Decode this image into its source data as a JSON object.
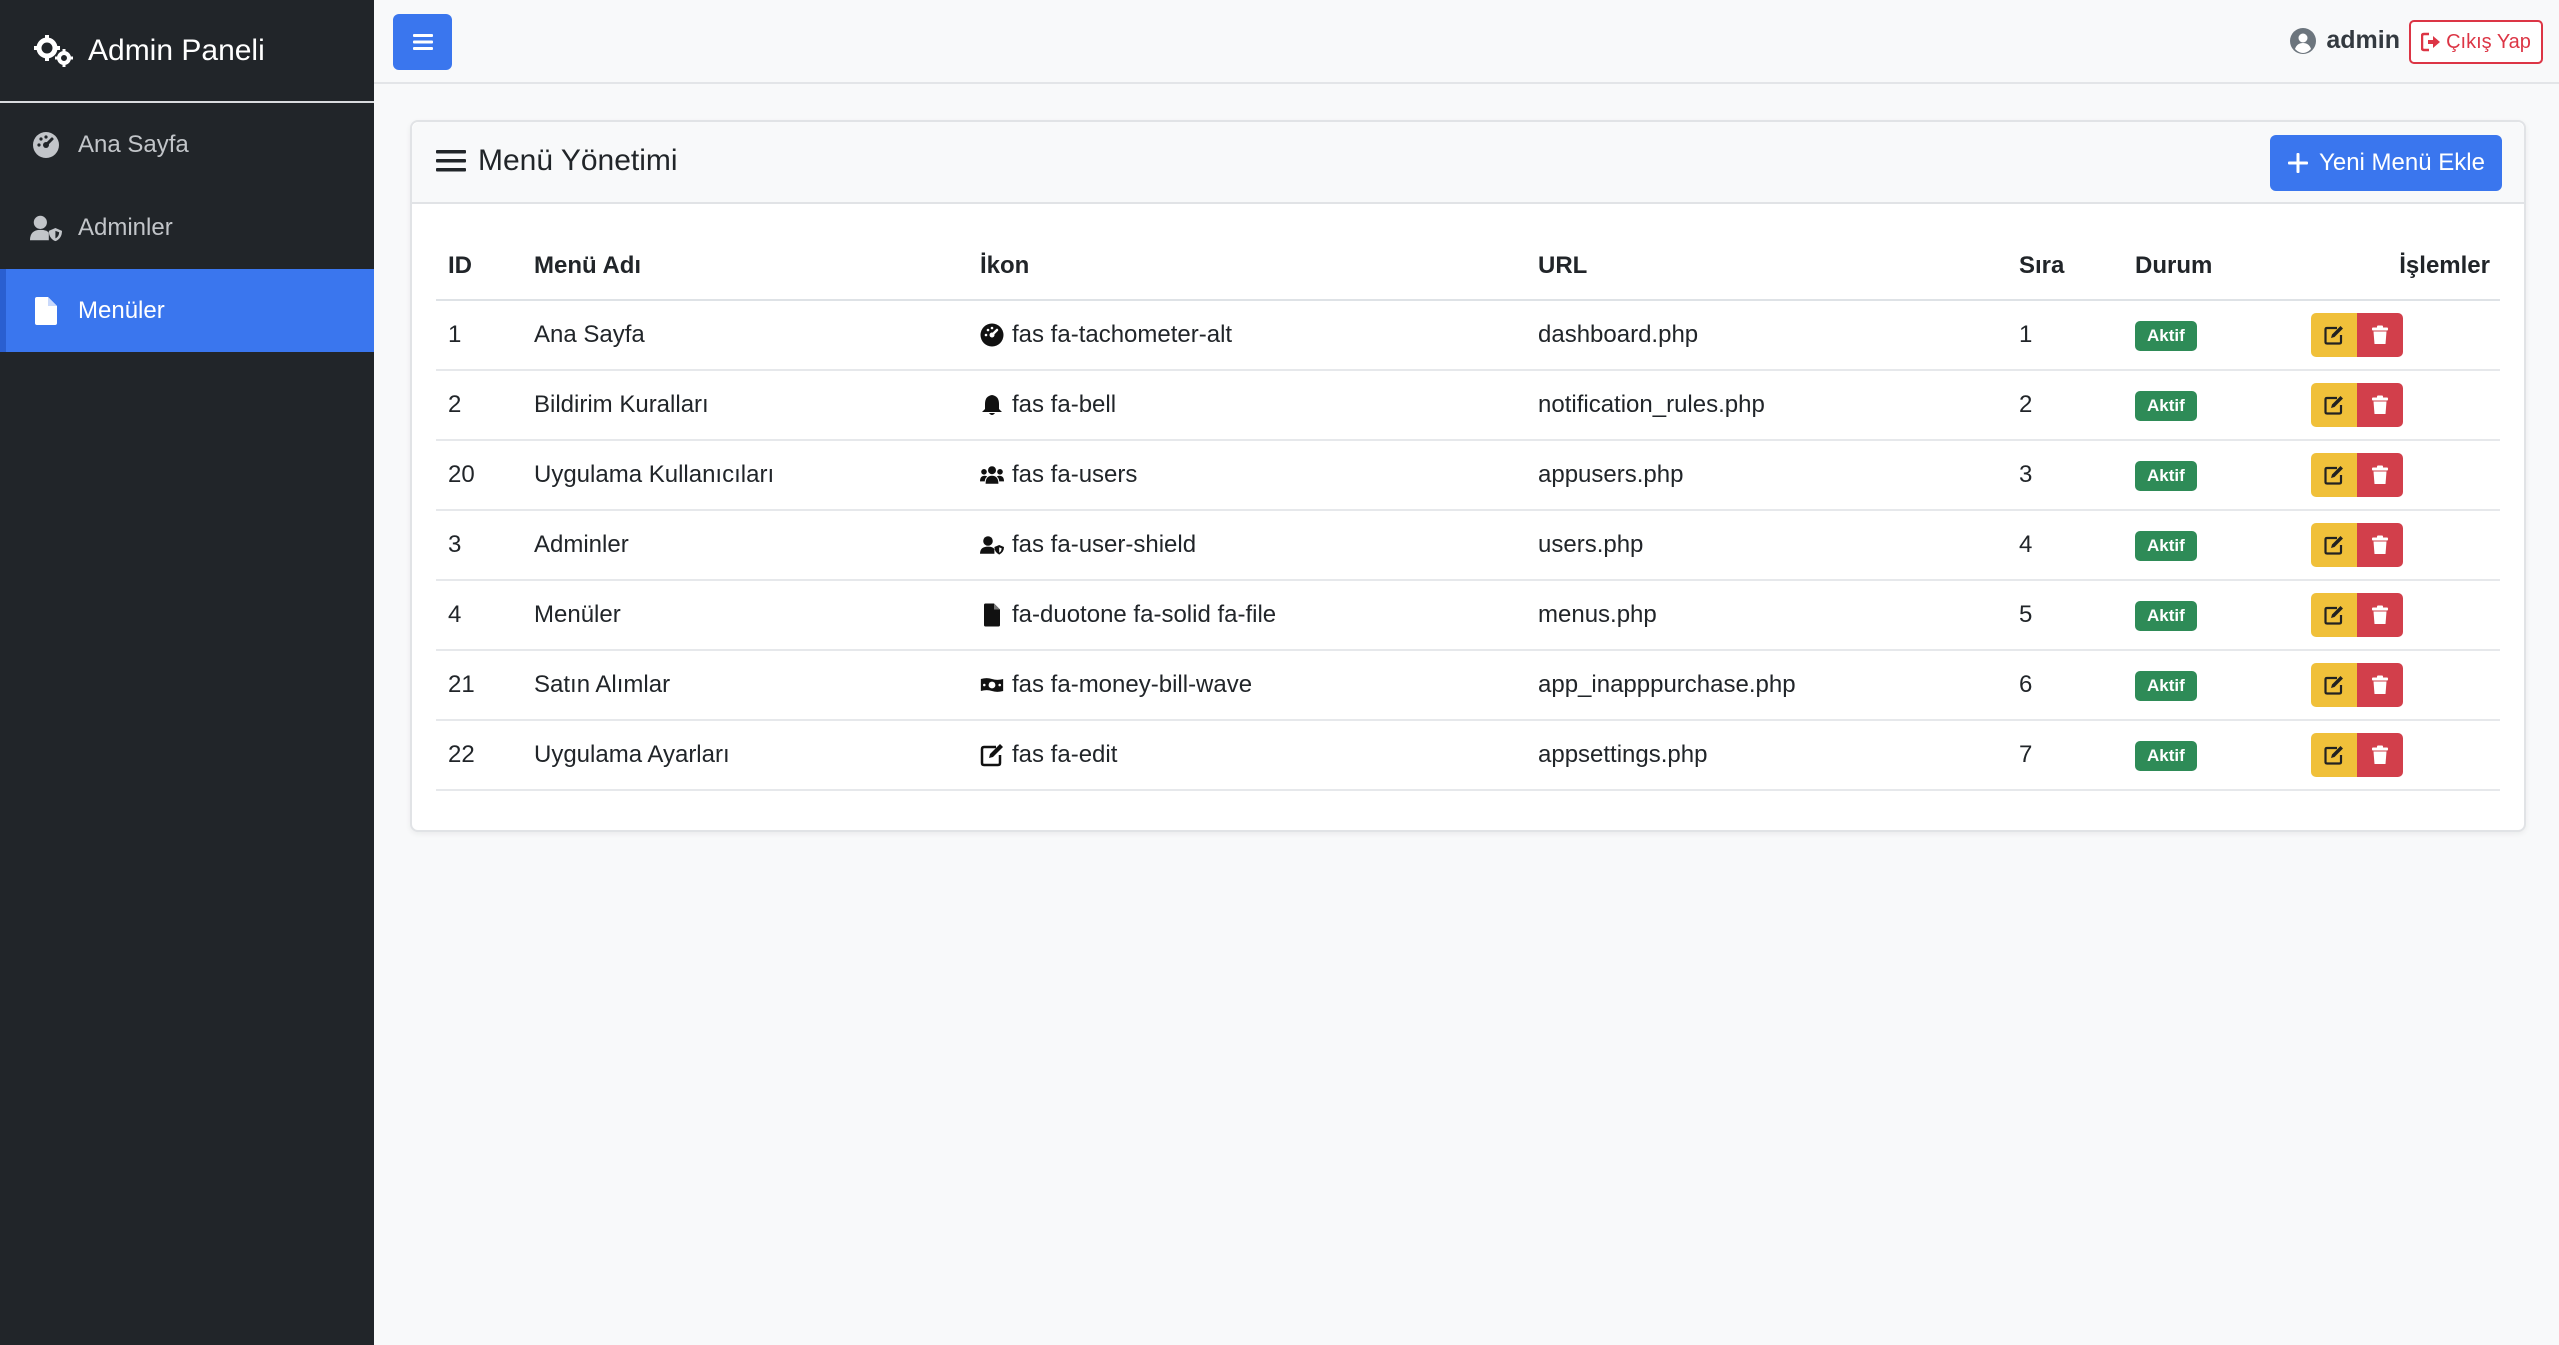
{
  "brand": {
    "title": "Admin Paneli",
    "icon": "gears-icon"
  },
  "sidebar": {
    "items": [
      {
        "label": "Ana Sayfa",
        "icon": "tachometer-icon",
        "active": false
      },
      {
        "label": "Adminler",
        "icon": "user-shield-icon",
        "active": false
      },
      {
        "label": "Menüler",
        "icon": "file-icon",
        "active": true
      }
    ]
  },
  "topbar": {
    "toggle_icon": "bars-icon",
    "username": "admin",
    "logout_label": "Çıkış Yap"
  },
  "card": {
    "title": "Menü Yönetimi",
    "add_button_label": "Yeni Menü Ekle"
  },
  "table": {
    "headers": [
      "ID",
      "Menü Adı",
      "İkon",
      "URL",
      "Sıra",
      "Durum",
      "İşlemler"
    ],
    "rows": [
      {
        "id": "1",
        "name": "Ana Sayfa",
        "icon": "fas fa-tachometer-alt",
        "url": "dashboard.php",
        "order": "1",
        "status": "Aktif"
      },
      {
        "id": "2",
        "name": "Bildirim Kuralları",
        "icon": "fas fa-bell",
        "url": "notification_rules.php",
        "order": "2",
        "status": "Aktif"
      },
      {
        "id": "20",
        "name": "Uygulama Kullanıcıları",
        "icon": "fas fa-users",
        "url": "appusers.php",
        "order": "3",
        "status": "Aktif"
      },
      {
        "id": "3",
        "name": "Adminler",
        "icon": "fas fa-user-shield",
        "url": "users.php",
        "order": "4",
        "status": "Aktif"
      },
      {
        "id": "4",
        "name": "Menüler",
        "icon": "fa-duotone fa-solid fa-file",
        "url": "menus.php",
        "order": "5",
        "status": "Aktif"
      },
      {
        "id": "21",
        "name": "Satın Alımlar",
        "icon": "fas fa-money-bill-wave",
        "url": "app_inapppurchase.php",
        "order": "6",
        "status": "Aktif"
      },
      {
        "id": "22",
        "name": "Uygulama Ayarları",
        "icon": "fas fa-edit",
        "url": "appsettings.php",
        "order": "7",
        "status": "Aktif"
      }
    ]
  },
  "colors": {
    "sidebar_bg": "#212529",
    "primary": "#3a76ee",
    "success": "#2e8b57",
    "warning": "#f0c03a",
    "danger": "#d23f4b"
  }
}
